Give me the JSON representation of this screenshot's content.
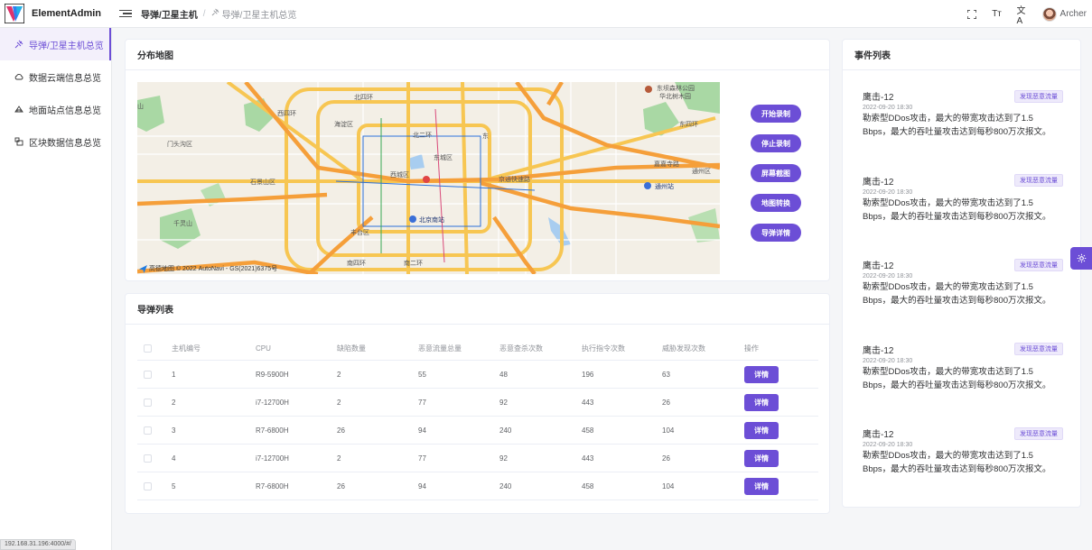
{
  "app": {
    "name": "ElementAdmin"
  },
  "breadcrumb": {
    "current": "导弹/卫星主机",
    "separator": "/",
    "sub": "导弹/卫星主机总览"
  },
  "header": {
    "user_name": "Archer"
  },
  "sidebar": {
    "items": [
      {
        "label": "导弹/卫星主机总览",
        "icon": "satellite-icon",
        "active": true
      },
      {
        "label": "数据云端信息总览",
        "icon": "cloud-icon",
        "active": false
      },
      {
        "label": "地面站点信息总览",
        "icon": "ground-station-icon",
        "active": false
      },
      {
        "label": "区块数据信息总览",
        "icon": "blocks-icon",
        "active": false
      }
    ]
  },
  "status_url": "192.168.31.196:4000/#/",
  "map_card": {
    "title": "分布地图",
    "labels": {
      "l1": "北四环",
      "l2": "东四环",
      "l3": "东坝森林公园",
      "l4": "华北树木园",
      "l5": "门头沟区",
      "l6": "海淀区",
      "l7": "北二环",
      "l8": "东城区",
      "l9": "东",
      "l10": "石景山区",
      "l11": "西城区",
      "l12": "京通快速路",
      "l13": "通州站",
      "l14": "千灵山",
      "l15": "北京南站",
      "l16": "丰台区",
      "l17": "南四环",
      "l18": "南二环",
      "l19": "通州区",
      "l20": "西四环",
      "l21": "嘉嘉寺路",
      "l22": "山"
    },
    "footer": "高德地图 © 2022 AutoNavi - GS(2021)6375号",
    "buttons": [
      "开始录制",
      "停止录制",
      "屏幕截图",
      "地图转换",
      "导弹详情"
    ]
  },
  "list_card": {
    "title": "导弹列表",
    "columns": [
      "主机编号",
      "CPU",
      "缺陷数量",
      "恶意流量总量",
      "恶意查杀次数",
      "执行指令次数",
      "威胁发现次数",
      "操作"
    ],
    "rows": [
      {
        "id": "1",
        "cpu": "R9-5900H",
        "defects": "2",
        "malicious_traffic": "55",
        "kills": "48",
        "commands": "196",
        "threats": "63",
        "action": "详情"
      },
      {
        "id": "2",
        "cpu": "i7-12700H",
        "defects": "2",
        "malicious_traffic": "77",
        "kills": "92",
        "commands": "443",
        "threats": "26",
        "action": "详情"
      },
      {
        "id": "3",
        "cpu": "R7-6800H",
        "defects": "26",
        "malicious_traffic": "94",
        "kills": "240",
        "commands": "458",
        "threats": "104",
        "action": "详情"
      },
      {
        "id": "4",
        "cpu": "i7-12700H",
        "defects": "2",
        "malicious_traffic": "77",
        "kills": "92",
        "commands": "443",
        "threats": "26",
        "action": "详情"
      },
      {
        "id": "5",
        "cpu": "R7-6800H",
        "defects": "26",
        "malicious_traffic": "94",
        "kills": "240",
        "commands": "458",
        "threats": "104",
        "action": "详情"
      }
    ]
  },
  "event_card": {
    "title": "事件列表",
    "events": [
      {
        "title": "鹰击-12",
        "tag": "发现恶意流量",
        "time": "2022-09-20 18:30",
        "desc": "勒索型DDos攻击，最大的带宽攻击达到了1.5 Bbps，最大的吞吐量攻击达到每秒800万次报文。"
      },
      {
        "title": "鹰击-12",
        "tag": "发现恶意流量",
        "time": "2022-09-20 18:30",
        "desc": "勒索型DDos攻击，最大的带宽攻击达到了1.5 Bbps，最大的吞吐量攻击达到每秒800万次报文。"
      },
      {
        "title": "鹰击-12",
        "tag": "发现恶意流量",
        "time": "2022-09-20 18:30",
        "desc": "勒索型DDos攻击，最大的带宽攻击达到了1.5 Bbps，最大的吞吐量攻击达到每秒800万次报文。"
      },
      {
        "title": "鹰击-12",
        "tag": "发现恶意流量",
        "time": "2022-09-20 18:30",
        "desc": "勒索型DDos攻击，最大的带宽攻击达到了1.5 Bbps，最大的吞吐量攻击达到每秒800万次报文。"
      },
      {
        "title": "鹰击-12",
        "tag": "发现恶意流量",
        "time": "2022-09-20 18:30",
        "desc": "勒索型DDos攻击，最大的带宽攻击达到了1.5 Bbps，最大的吞吐量攻击达到每秒800万次报文。"
      }
    ]
  },
  "colors": {
    "accent": "#6c4ed6",
    "page_bg": "#f5f6f8",
    "card_border": "#ebeef5"
  }
}
